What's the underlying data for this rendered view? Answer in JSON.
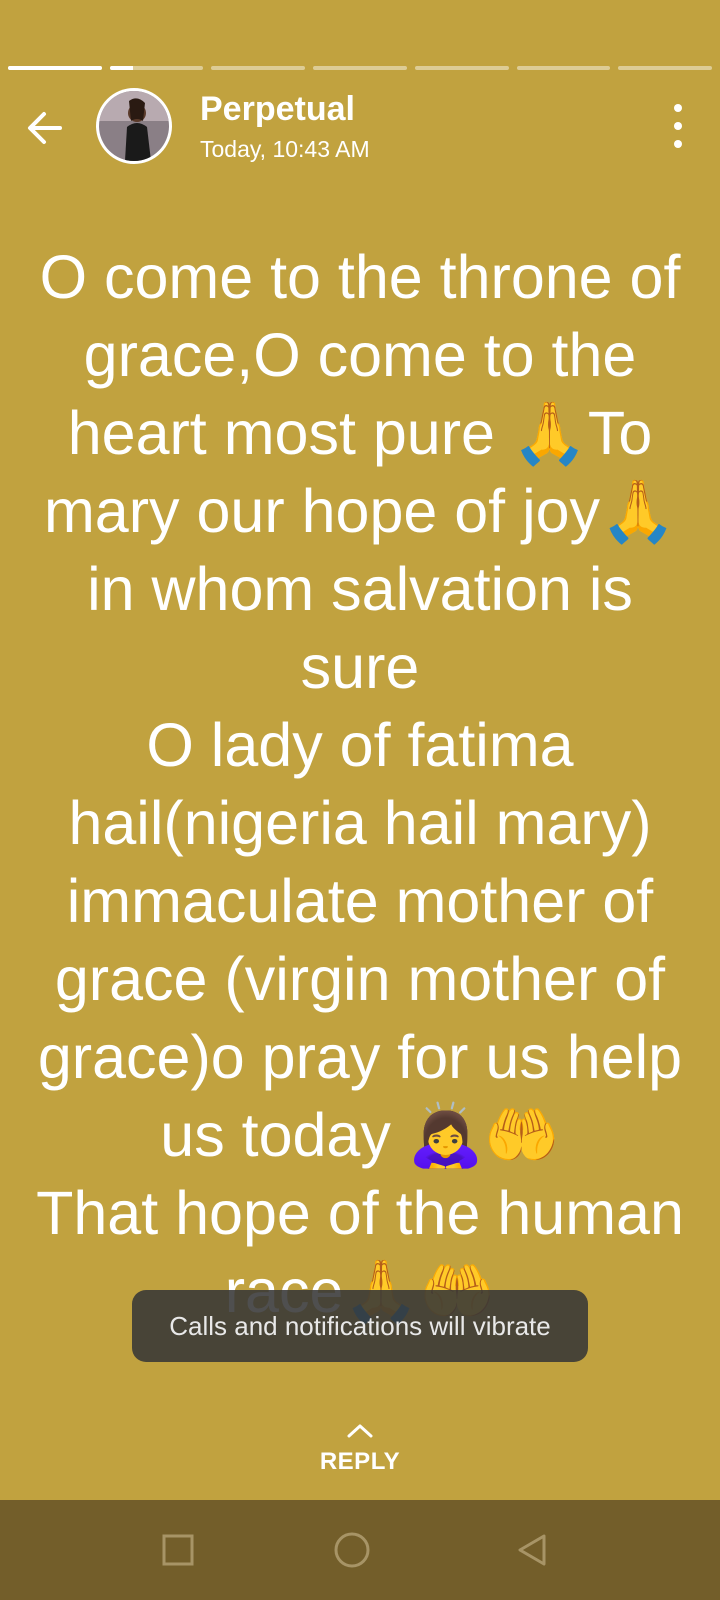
{
  "progress": {
    "segments": 7,
    "current_index": 1,
    "current_fill": 0.25
  },
  "header": {
    "back_icon": "arrow-left-icon",
    "contact_name": "Perpetual",
    "timestamp": "Today, 10:43 AM",
    "menu_icon": "more-vertical-icon"
  },
  "status": {
    "background_color": "#c1a23f",
    "text": "O come to the throne of grace,O come to the heart most pure 🙏To mary our hope of joy🙏 in whom salvation is sure\nO lady of fatima hail(nigeria hail mary) immaculate mother of grace (virgin mother of grace)o pray for us help us today 🙇‍♀️🤲\nThat hope of the human race🙏🤲"
  },
  "toast": {
    "text": "Calls and notifications will vibrate"
  },
  "reply": {
    "label": "REPLY",
    "icon": "chevron-up-icon"
  },
  "navbar": {
    "background_color": "#735e2a",
    "buttons": [
      "recents-square-icon",
      "home-circle-icon",
      "back-triangle-icon"
    ]
  }
}
